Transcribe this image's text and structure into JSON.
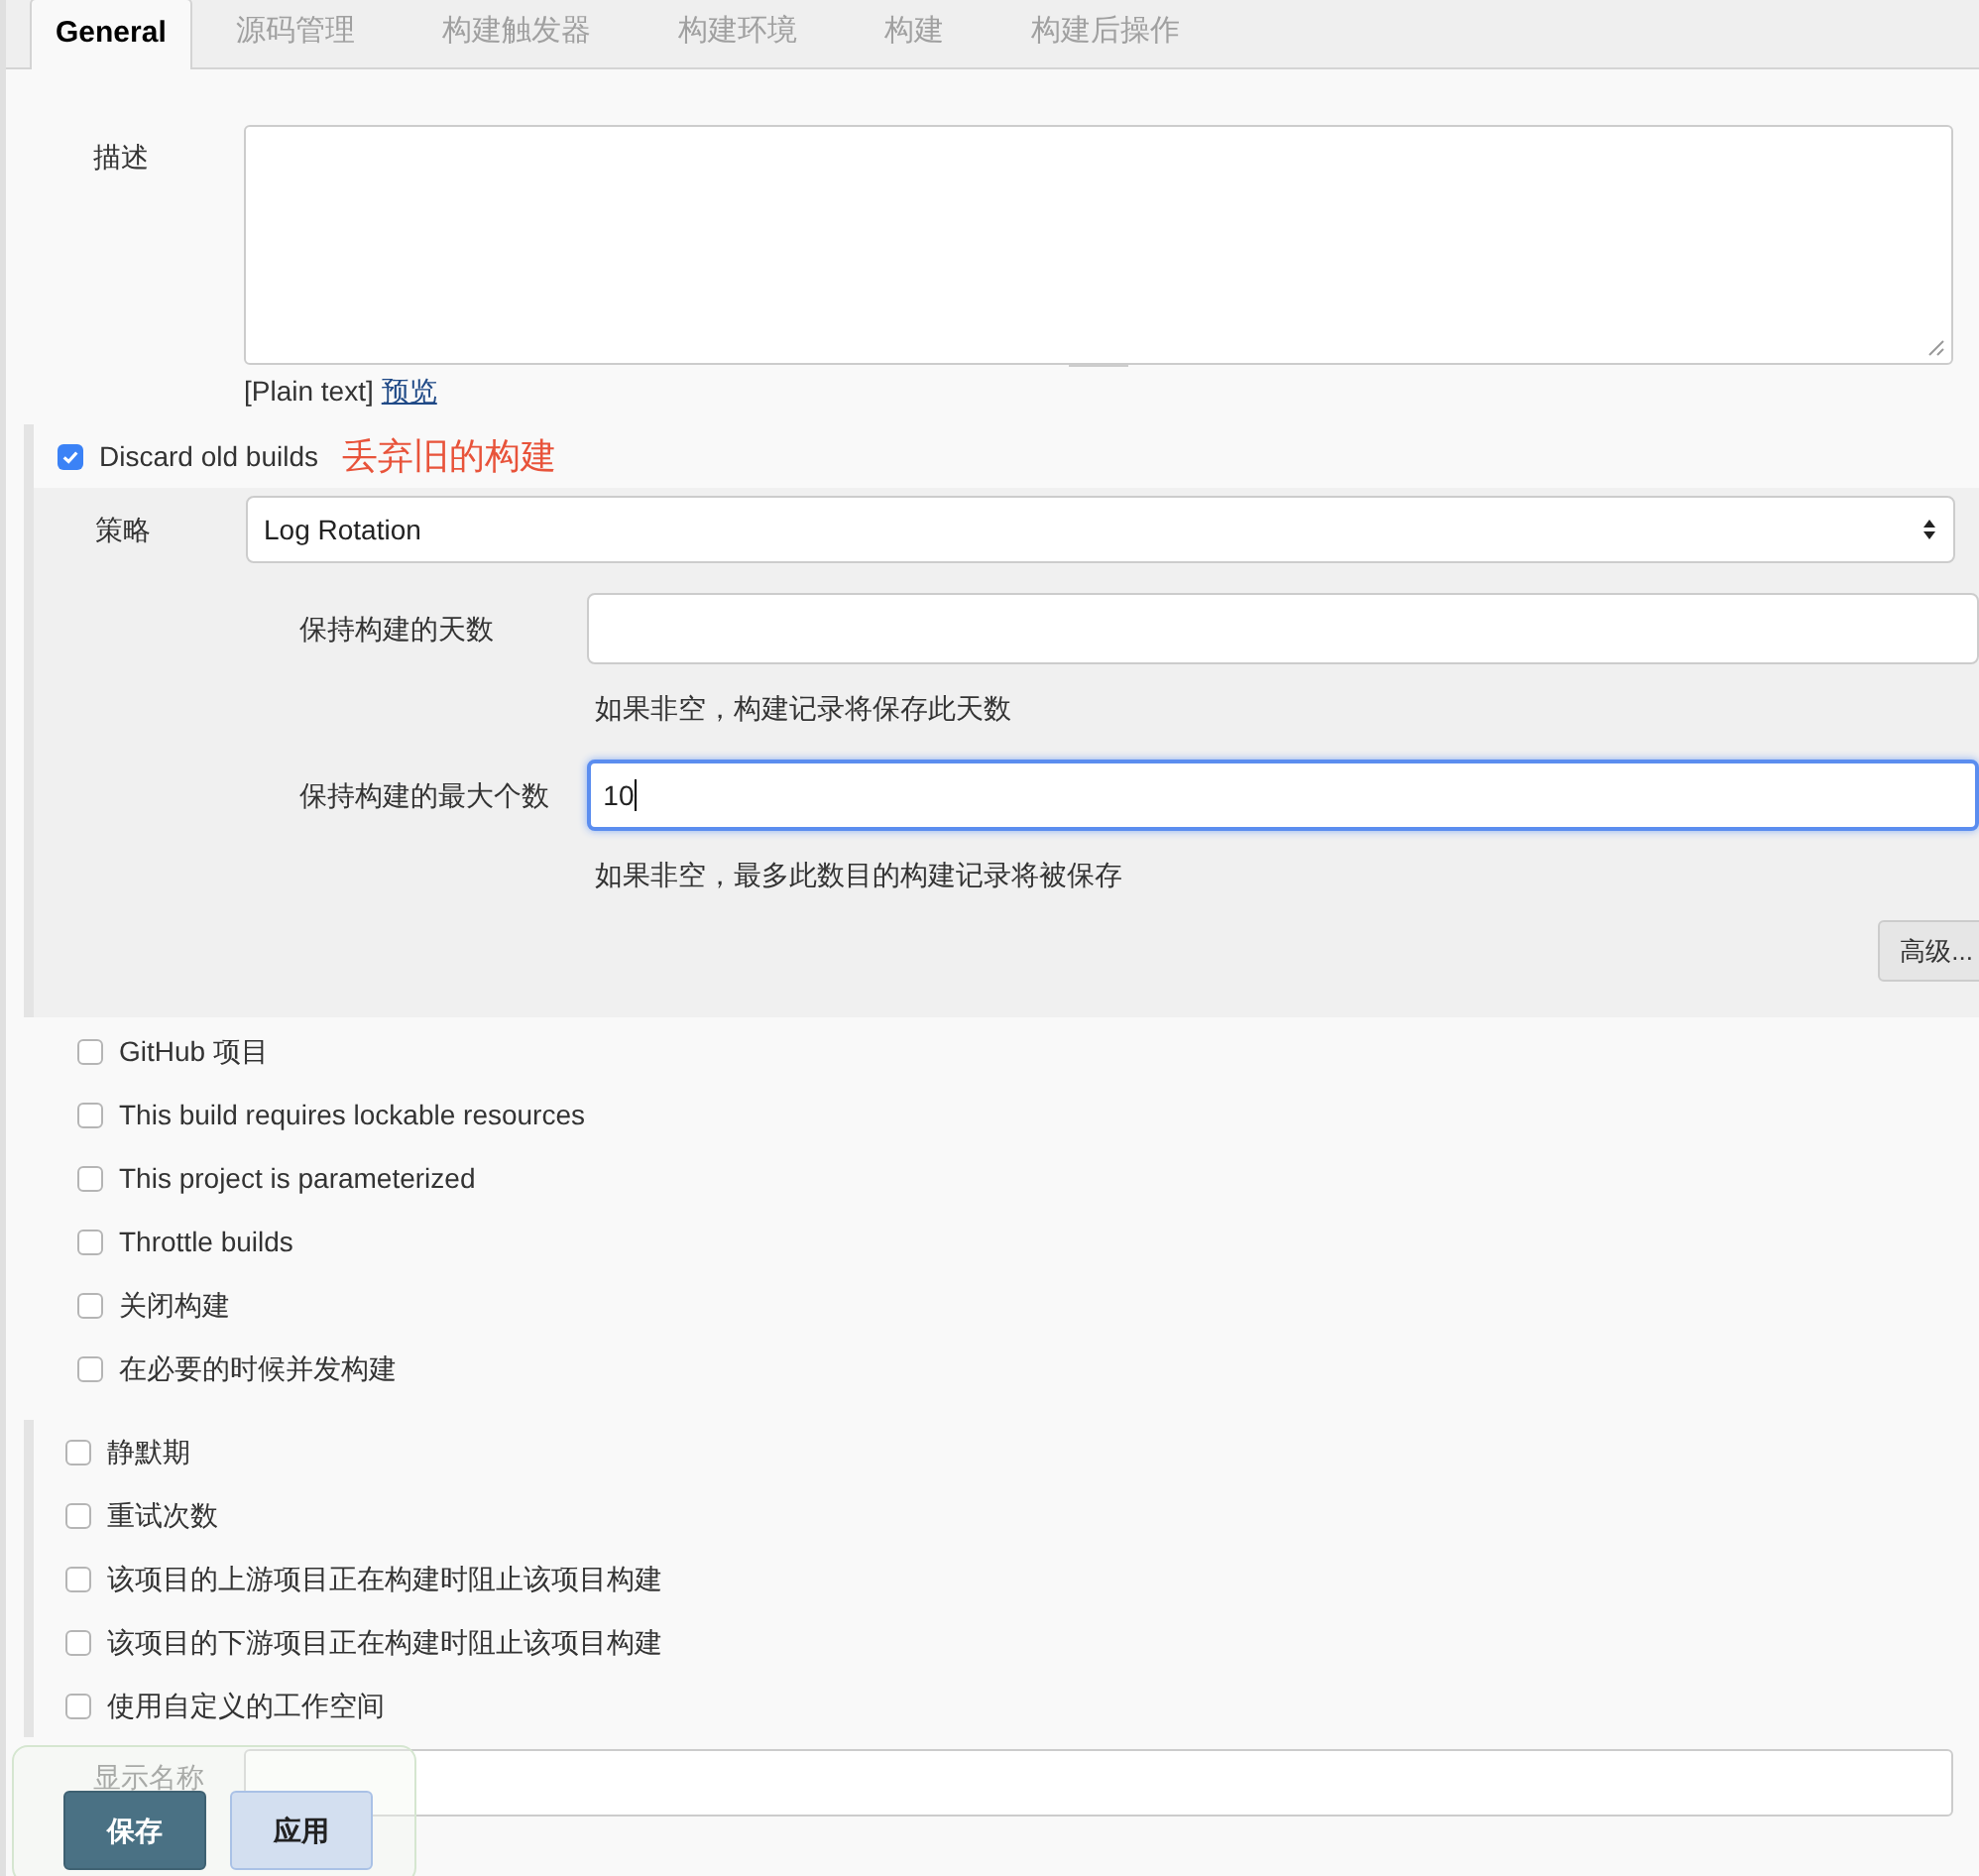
{
  "tabs": [
    {
      "label": "General",
      "selected": true
    },
    {
      "label": "源码管理",
      "selected": false
    },
    {
      "label": "构建触发器",
      "selected": false
    },
    {
      "label": "构建环境",
      "selected": false
    },
    {
      "label": "构建",
      "selected": false
    },
    {
      "label": "构建后操作",
      "selected": false
    }
  ],
  "description": {
    "label": "描述",
    "format_note": "[Plain text]",
    "preview_link": "预览"
  },
  "discard": {
    "label": "Discard old builds",
    "checked": true,
    "annotation": "丢弃旧的构建",
    "strategy_label": "策略",
    "strategy_value": "Log Rotation",
    "fields": [
      {
        "label": "保持构建的天数",
        "focused": false,
        "help": "如果非空，构建记录将保存此天数"
      },
      {
        "label": "保持构建的最大个数",
        "value": "10",
        "focused": true,
        "help": "如果非空，最多此数目的构建记录将被保存"
      }
    ],
    "advanced_button": "高级..."
  },
  "options_group_1": [
    {
      "label": "GitHub 项目",
      "checked": false
    },
    {
      "label": "This build requires lockable resources",
      "checked": false
    },
    {
      "label": "This project is parameterized",
      "checked": false
    },
    {
      "label": "Throttle builds",
      "checked": false
    },
    {
      "label": "关闭构建",
      "checked": false
    },
    {
      "label": "在必要的时候并发构建",
      "checked": false
    }
  ],
  "options_group_2": [
    {
      "label": "静默期",
      "checked": false
    },
    {
      "label": "重试次数",
      "checked": false
    },
    {
      "label": "该项目的上游项目正在构建时阻止该项目构建",
      "checked": false
    },
    {
      "label": "该项目的下游项目正在构建时阻止该项目构建",
      "checked": false
    },
    {
      "label": "使用自定义的工作空间",
      "checked": false
    }
  ],
  "display_name": {
    "label": "显示名称"
  },
  "buttons": [
    {
      "label": "保存",
      "kind": "primary"
    },
    {
      "label": "应用",
      "kind": "secondary"
    }
  ]
}
